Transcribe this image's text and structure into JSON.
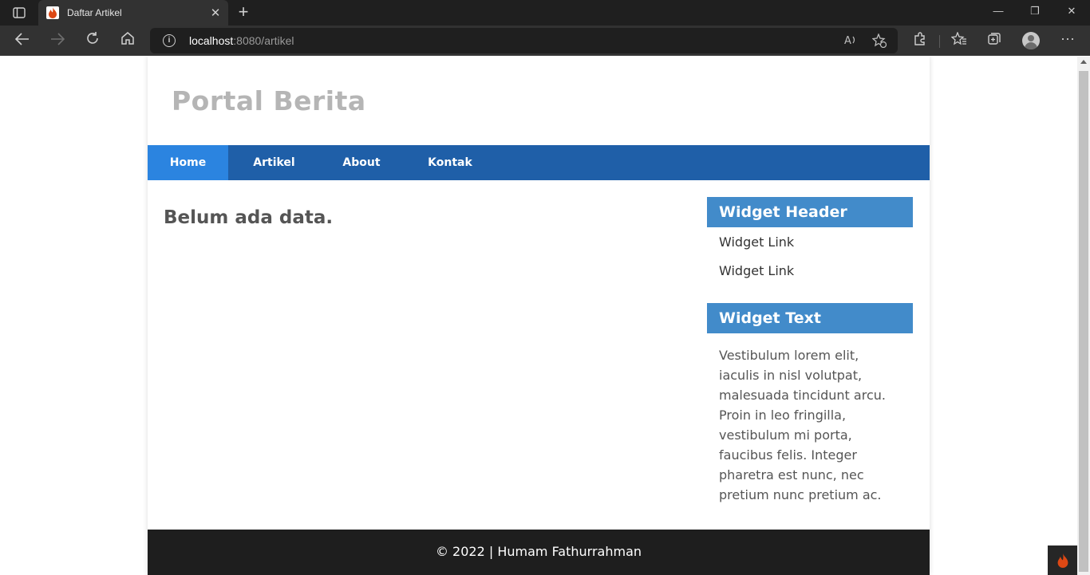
{
  "browser": {
    "tab_title": "Daftar Artikel",
    "tab_close": "✕",
    "new_tab": "+",
    "url_host": "localhost",
    "url_rest": ":8080/artikel",
    "window_controls": {
      "minimize": "—",
      "restore": "❐",
      "close": "✕"
    }
  },
  "site": {
    "title": "Portal Berita",
    "nav": [
      {
        "label": "Home",
        "active": true
      },
      {
        "label": "Artikel",
        "active": false
      },
      {
        "label": "About",
        "active": false
      },
      {
        "label": "Kontak",
        "active": false
      }
    ],
    "main_message": "Belum ada data.",
    "sidebar": {
      "widget1_header": "Widget Header",
      "widget1_links": [
        "Widget Link",
        "Widget Link"
      ],
      "widget2_header": "Widget Text",
      "widget2_text": "Vestibulum lorem elit, iaculis in nisl volutpat, malesuada tincidunt arcu. Proin in leo fringilla, vestibulum mi porta, faucibus felis. Integer pharetra est nunc, nec pretium nunc pretium ac."
    },
    "footer": "© 2022 | Humam Fathurrahman"
  },
  "colors": {
    "nav_bg": "#1f5fa8",
    "nav_active": "#2b84e0",
    "widget_header": "#428bca",
    "footer_bg": "#1e1e1e"
  }
}
